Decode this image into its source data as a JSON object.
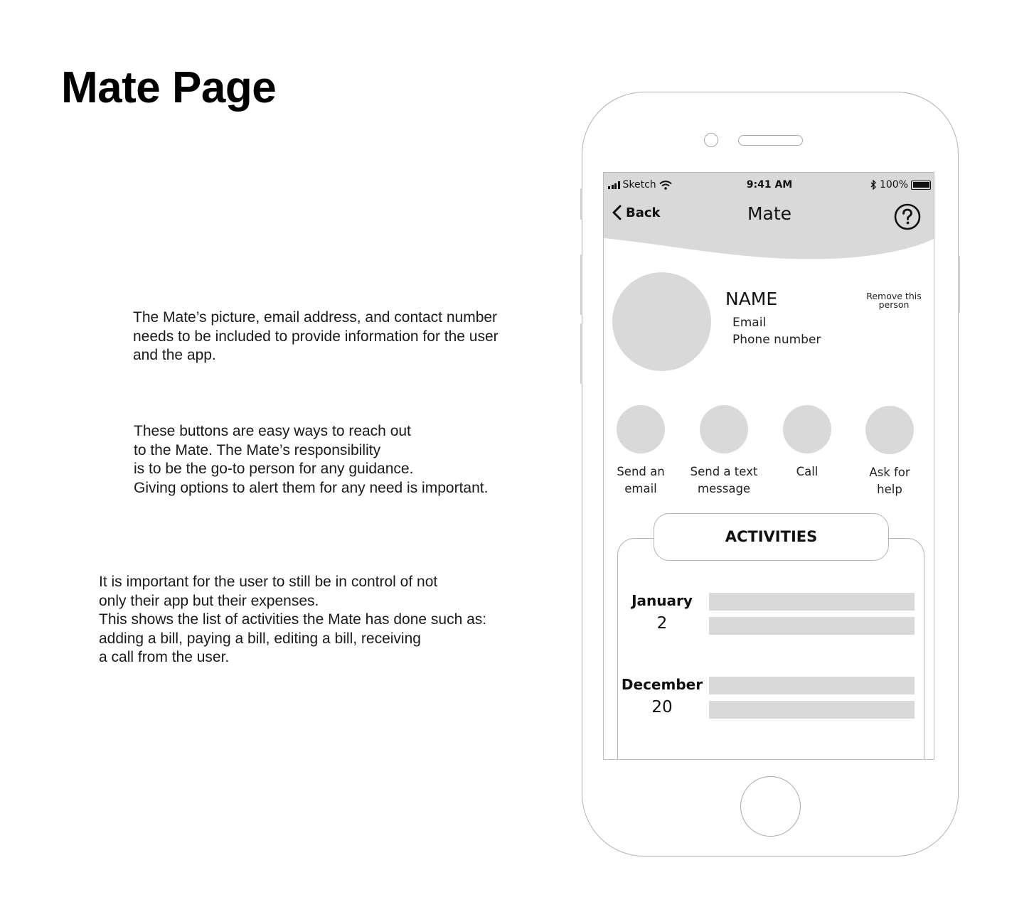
{
  "page": {
    "title": "Mate Page"
  },
  "annotations": [
    "The Mate’s picture, email address, and contact number\nneeds to be included to provide information for the user\nand the app.",
    "These buttons are easy ways to reach out\nto the Mate. The Mate’s responsibility\nis to be the go-to person for any guidance.\nGiving options to alert them for any need is important.",
    "It is important for the user to still be in control of not\nonly their app but their expenses.\nThis shows the list of activities the Mate has done such as:\nadding a bill, paying a bill, editing a bill, receiving\na call from the user."
  ],
  "status_bar": {
    "carrier": "Sketch",
    "time": "9:41 AM",
    "battery": "100%"
  },
  "nav": {
    "back_label": "Back",
    "title": "Mate"
  },
  "profile": {
    "name": "NAME",
    "email": "Email",
    "phone": "Phone number",
    "remove_label": "Remove this person"
  },
  "actions": [
    {
      "label": "Send an\nemail"
    },
    {
      "label": "Send a text\nmessage"
    },
    {
      "label": "Call"
    },
    {
      "label": "Ask for\nhelp"
    }
  ],
  "activities": {
    "title": "ACTIVITIES",
    "entries": [
      {
        "month": "January",
        "day": "2"
      },
      {
        "month": "December",
        "day": "20"
      }
    ]
  },
  "colors": {
    "placeholder": "#d9d9d9",
    "header": "#d9d9d9",
    "outline": "#b3b3b3"
  }
}
